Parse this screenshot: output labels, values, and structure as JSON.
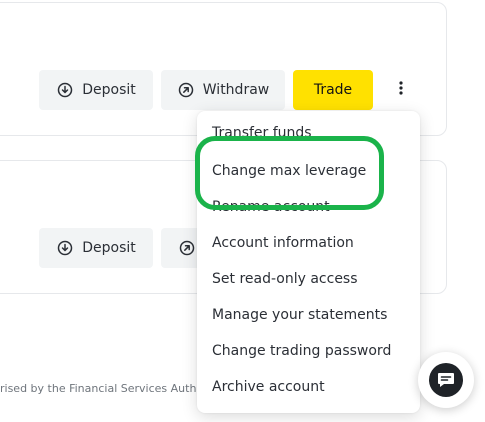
{
  "accounts": [
    {
      "deposit_label": "Deposit",
      "withdraw_label": "Withdraw",
      "trade_label": "Trade"
    },
    {
      "deposit_label": "Deposit"
    }
  ],
  "footer": {
    "regulatory_text": "rised by the Financial Services Author"
  },
  "menu": {
    "items": [
      {
        "label": "Transfer funds"
      },
      {
        "label": "Change max leverage"
      },
      {
        "label": "Rename account"
      },
      {
        "label": "Account information"
      },
      {
        "label": "Set read-only access"
      },
      {
        "label": "Manage your statements"
      },
      {
        "label": "Change trading password"
      },
      {
        "label": "Archive account"
      }
    ],
    "highlighted_index": 1
  },
  "colors": {
    "accent": "#ffe100",
    "highlight_ring": "#1ab34a",
    "secondary_button": "#f2f4f5"
  }
}
